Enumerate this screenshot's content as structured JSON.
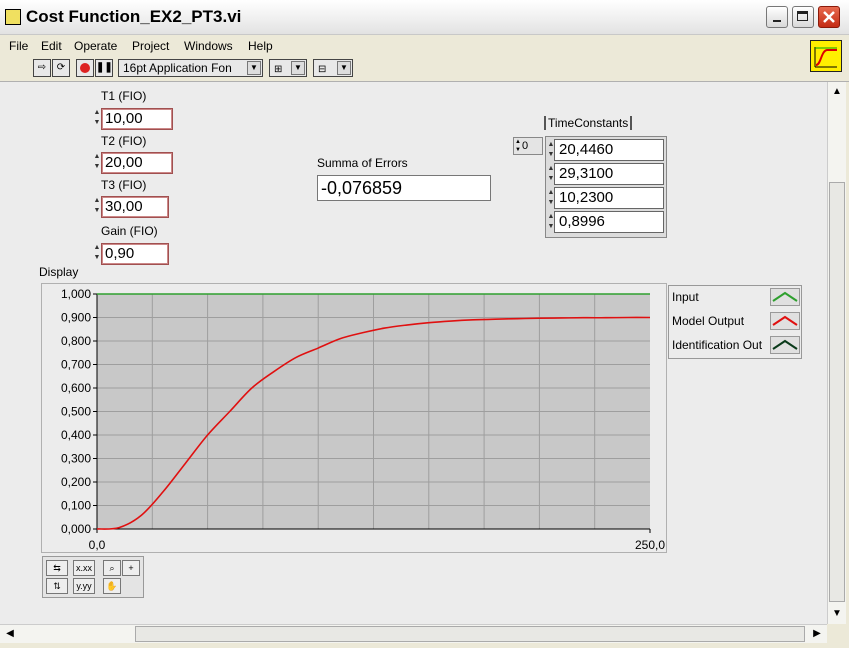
{
  "window": {
    "title": "Cost Function_EX2_PT3.vi"
  },
  "menu": [
    "File",
    "Edit",
    "Operate",
    "Project",
    "Windows",
    "Help"
  ],
  "toolbar": {
    "font_select": "16pt Application Fon"
  },
  "controls": {
    "t1": {
      "label": "T1  (FIO)",
      "value": "10,00"
    },
    "t2": {
      "label": "T2  (FIO)",
      "value": "20,00"
    },
    "t3": {
      "label": "T3  (FIO)",
      "value": "30,00"
    },
    "gain": {
      "label": "Gain (FIO)",
      "value": "0,90"
    }
  },
  "summa": {
    "label": "Summa of Errors",
    "value": "-0,076859"
  },
  "time_constants": {
    "label": "TimeConstants",
    "index": "0",
    "values": [
      "20,4460",
      "29,3100",
      "10,2300",
      "0,8996"
    ]
  },
  "graph": {
    "label": "Display",
    "colors": {
      "plot_bg": "#c8c8c8",
      "grid": "#9e9e9e",
      "input": "#2ea02e",
      "model_output": "#e01010",
      "identification": "#0a3a1a"
    }
  },
  "chart_data": {
    "type": "line",
    "title": "Display",
    "xlim": [
      0,
      250
    ],
    "ylim": [
      0,
      1
    ],
    "x_ticks": [
      "0,0",
      "250,0"
    ],
    "y_ticks": [
      "0,000",
      "0,100",
      "0,200",
      "0,300",
      "0,400",
      "0,500",
      "0,600",
      "0,700",
      "0,800",
      "0,900",
      "1,000"
    ],
    "grid": true,
    "legend_position": "right",
    "series": [
      {
        "name": "Input",
        "color": "#2ea02e",
        "x": [
          0,
          250
        ],
        "y": [
          1.0,
          1.0
        ]
      },
      {
        "name": "Model Output",
        "color": "#e01010",
        "x": [
          0,
          10,
          20,
          30,
          40,
          50,
          60,
          70,
          80,
          90,
          100,
          110,
          120,
          130,
          140,
          150,
          160,
          170,
          180,
          190,
          200,
          210,
          220,
          230,
          240,
          250
        ],
        "y": [
          0.0,
          0.006,
          0.058,
          0.16,
          0.28,
          0.4,
          0.5,
          0.6,
          0.67,
          0.73,
          0.77,
          0.81,
          0.835,
          0.855,
          0.868,
          0.878,
          0.885,
          0.89,
          0.893,
          0.895,
          0.897,
          0.898,
          0.899,
          0.899,
          0.9,
          0.9
        ]
      },
      {
        "name": "Identification Out",
        "color": "#0a3a1a",
        "x": [],
        "y": []
      }
    ]
  }
}
